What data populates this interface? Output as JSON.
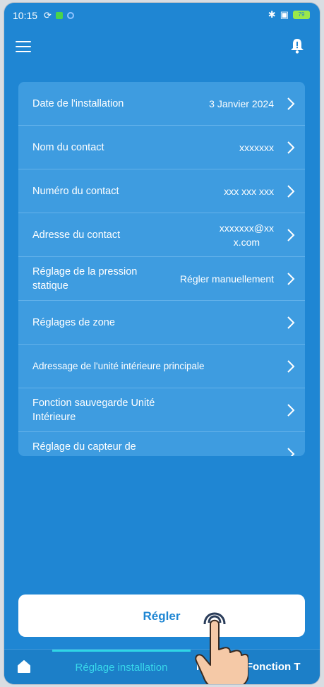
{
  "status_bar": {
    "time": "10:15",
    "battery": "79"
  },
  "settings": [
    {
      "label": "Date de l'installation",
      "value": "3 Janvier 2024"
    },
    {
      "label": "Nom du contact",
      "value": "xxxxxxx"
    },
    {
      "label": "Numéro du contact",
      "value": "xxx xxx xxx"
    },
    {
      "label": "Adresse du contact",
      "value": "xxxxxxx@xx\nx.com"
    },
    {
      "label": "Réglage de la pression statique",
      "value": "Régler manuellement"
    },
    {
      "label": "Réglages de zone",
      "value": ""
    },
    {
      "label": "Adressage de l'unité intérieure principale",
      "value": ""
    },
    {
      "label": "Fonction sauvegarde Unité Intérieure",
      "value": ""
    },
    {
      "label": "Réglage du capteur de mouvement",
      "value": ""
    }
  ],
  "primary_button": "Régler",
  "bottom_nav": {
    "active_tab": "Réglage installation",
    "next_tab": "Réglages Fonction T"
  },
  "colors": {
    "background": "#1f86d3",
    "card": "#3e9ce0",
    "active_tab": "#37d7ea",
    "button_text": "#1f86d3"
  },
  "icons": [
    "menu-icon",
    "bell-icon",
    "chevron-right-icon",
    "home-icon",
    "hand-pointer-icon"
  ]
}
